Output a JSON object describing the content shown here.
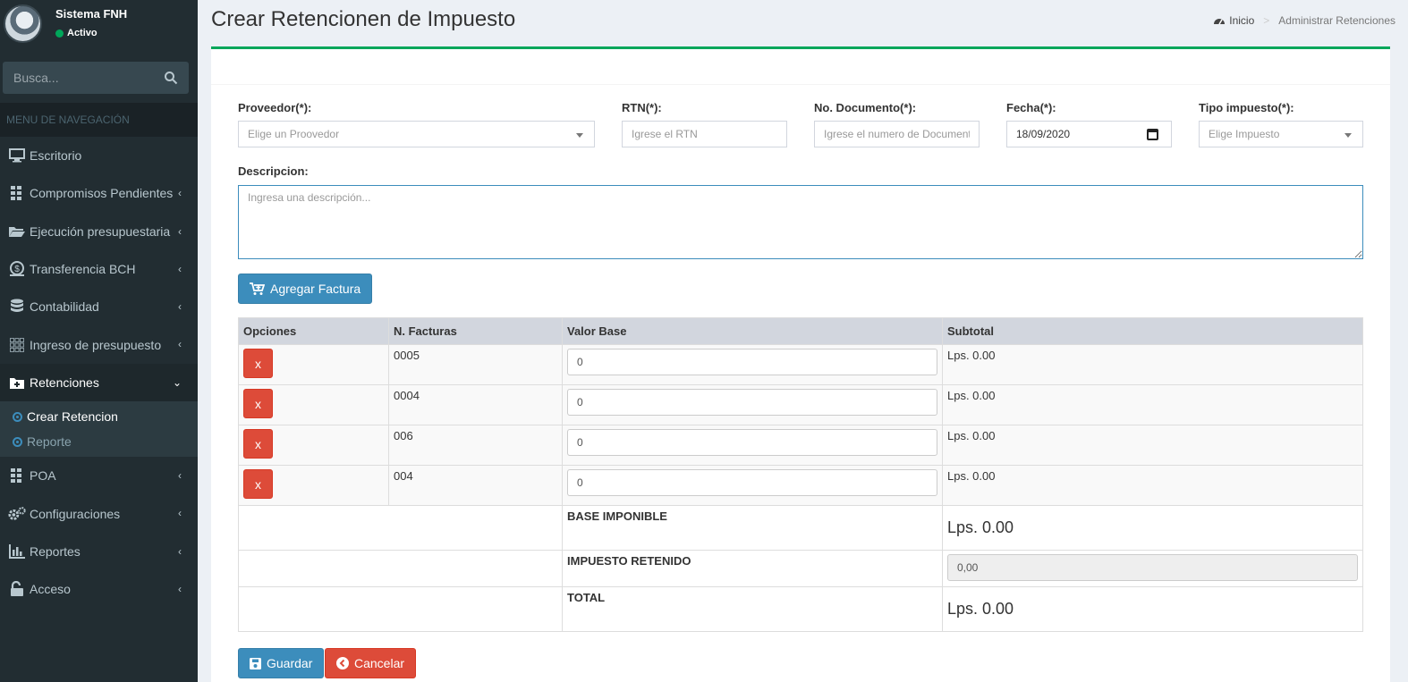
{
  "app": {
    "name": "Sistema FNH",
    "status": "Activo"
  },
  "search": {
    "placeholder": "Busca..."
  },
  "nav": {
    "header": "MENU DE NAVEGACIÓN",
    "items": [
      {
        "label": "Escritorio",
        "icon": "desktop-icon"
      },
      {
        "label": "Compromisos Pendientes",
        "icon": "grid-icon"
      },
      {
        "label": "Ejecución presupuestaria",
        "icon": "folder-open-icon"
      },
      {
        "label": "Transferencia BCH",
        "icon": "money-icon"
      },
      {
        "label": "Contabilidad",
        "icon": "database-icon"
      },
      {
        "label": "Ingreso de presupuesto",
        "icon": "grid-icon"
      },
      {
        "label": "Retenciones",
        "icon": "folder-plus-icon"
      },
      {
        "label": "POA",
        "icon": "grid-icon"
      },
      {
        "label": "Configuraciones",
        "icon": "gears-icon"
      },
      {
        "label": "Reportes",
        "icon": "bar-chart-icon"
      },
      {
        "label": "Acceso",
        "icon": "unlock-icon"
      }
    ],
    "sub_items": [
      {
        "label": "Crear Retencion"
      },
      {
        "label": "Reporte"
      }
    ]
  },
  "page": {
    "title": "Crear Retencionen de Impuesto"
  },
  "breadcrumb": {
    "home": "Inicio",
    "current": "Administrar Retenciones"
  },
  "form": {
    "proveedor": {
      "label": "Proveedor(*):",
      "placeholder": "Elige un Proovedor"
    },
    "rtn": {
      "label": "RTN(*):",
      "placeholder": "Igrese el RTN"
    },
    "documento": {
      "label": "No. Documento(*):",
      "placeholder": "Igrese el numero de Documento"
    },
    "fecha": {
      "label": "Fecha(*):",
      "value": "18/09/2020"
    },
    "tipo": {
      "label": "Tipo impuesto(*):",
      "placeholder": "Elige Impuesto"
    },
    "descripcion": {
      "label": "Descripcion:",
      "placeholder": "Ingresa una descripción..."
    }
  },
  "buttons": {
    "agregar": "Agregar Factura",
    "guardar": "Guardar",
    "cancelar": "Cancelar",
    "remove": "x"
  },
  "table": {
    "headers": [
      "Opciones",
      "N. Facturas",
      "Valor Base",
      "Subtotal"
    ],
    "rows": [
      {
        "factura": "0005",
        "valor": "0",
        "subtotal": "Lps. 0.00"
      },
      {
        "factura": "0004",
        "valor": "0",
        "subtotal": "Lps. 0.00"
      },
      {
        "factura": "006",
        "valor": "0",
        "subtotal": "Lps. 0.00"
      },
      {
        "factura": "004",
        "valor": "0",
        "subtotal": "Lps. 0.00"
      }
    ],
    "summary": {
      "base_label": "BASE IMPONIBLE",
      "base_value": "Lps. 0.00",
      "impuesto_label": "IMPUESTO RETENIDO",
      "impuesto_value": "0,00",
      "total_label": "TOTAL",
      "total_value": "Lps. 0.00"
    }
  },
  "colors": {
    "primary": "#3c8dbc",
    "danger": "#dd4b39",
    "success": "#00a65a",
    "sidebar": "#222d32"
  }
}
